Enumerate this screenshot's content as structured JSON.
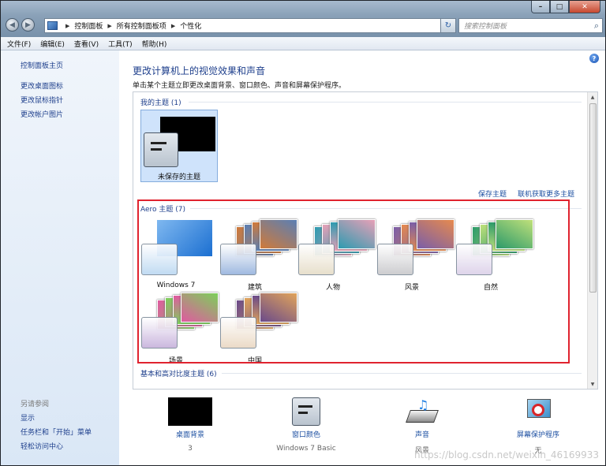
{
  "window": {
    "min": "–",
    "max": "□",
    "close": "✕"
  },
  "nav": {
    "back": "◀",
    "forward": "▶"
  },
  "address": {
    "crumbs": [
      "控制面板",
      "所有控制面板项",
      "个性化"
    ],
    "sep": "▶",
    "refresh": "↻"
  },
  "search": {
    "placeholder": "搜索控制面板"
  },
  "menu": [
    "文件(F)",
    "编辑(E)",
    "查看(V)",
    "工具(T)",
    "帮助(H)"
  ],
  "sidebar": {
    "home": "控制面板主页",
    "links": [
      "更改桌面图标",
      "更改鼠标指针",
      "更改帐户图片"
    ],
    "see_also": "另请参阅",
    "see_links": [
      "显示",
      "任务栏和「开始」菜单",
      "轻松访问中心"
    ]
  },
  "main": {
    "title": "更改计算机上的视觉效果和声音",
    "desc": "单击某个主题立即更改桌面背景、窗口颜色、声音和屏幕保护程序。",
    "help": "?"
  },
  "my_themes": {
    "title": "我的主题 (1)",
    "items": [
      {
        "label": "未保存的主题"
      }
    ],
    "save": "保存主题",
    "online": "联机获取更多主题"
  },
  "aero": {
    "title": "Aero 主题 (7)",
    "items": [
      {
        "label": "Windows 7",
        "colors": [
          "#1b6fd1",
          "#7fb8f0"
        ],
        "swatch": "#bcd9f2"
      },
      {
        "label": "建筑",
        "colors": [
          "#d07a3a",
          "#5a7fb4"
        ],
        "swatch": "#98b4de"
      },
      {
        "label": "人物",
        "colors": [
          "#2d9bb0",
          "#e7a0b7"
        ],
        "swatch": "#e6ddc8"
      },
      {
        "label": "风景",
        "colors": [
          "#7a5ea8",
          "#e68a4e"
        ],
        "swatch": "#c9c9cc"
      },
      {
        "label": "自然",
        "colors": [
          "#2c9a6a",
          "#bfe07a"
        ],
        "swatch": "#dcd1e9"
      },
      {
        "label": "场景",
        "colors": [
          "#e05aa0",
          "#7cd05a"
        ],
        "swatch": "#c7b2dc"
      },
      {
        "label": "中国",
        "colors": [
          "#6a4a8a",
          "#e1a45a"
        ],
        "swatch": "#ead8c3"
      }
    ]
  },
  "basic": {
    "title": "基本和高对比度主题 (6)"
  },
  "bottom": [
    {
      "label": "桌面背景",
      "sub": "3"
    },
    {
      "label": "窗口颜色",
      "sub": "Windows 7 Basic"
    },
    {
      "label": "声音",
      "sub": "风景"
    },
    {
      "label": "屏幕保护程序",
      "sub": "无"
    }
  ],
  "watermark": "https://blog.csdn.net/weixin_46169933"
}
